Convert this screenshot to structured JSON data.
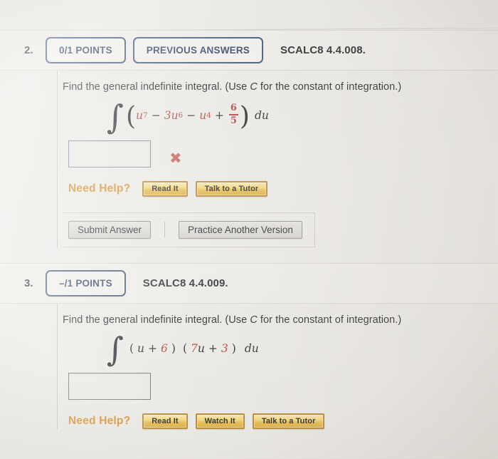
{
  "questions": [
    {
      "number": "2.",
      "points_label": "0/1 POINTS",
      "previous_answers_label": "PREVIOUS ANSWERS",
      "code": "SCALC8 4.4.008.",
      "prompt_before": "Find the general indefinite integral. (Use ",
      "prompt_var": "C",
      "prompt_after": " for the constant of integration.)",
      "integral": {
        "symbol": "∫",
        "open_paren": "(",
        "close_paren": ")",
        "terms": [
          {
            "base": "u",
            "exp": "7",
            "coef": "",
            "op": ""
          },
          {
            "base": "u",
            "exp": "6",
            "coef": "3",
            "op": "−"
          },
          {
            "base": "u",
            "exp": "4",
            "coef": "",
            "op": "−"
          }
        ],
        "plus_op": "+",
        "fraction_num": "6",
        "fraction_den": "5",
        "differential": "du"
      },
      "answer_value": "",
      "answer_status_icon": "✖",
      "answer_status_name": "incorrect-x-icon",
      "need_help_label": "Need Help?",
      "help_buttons": [
        "Read It",
        "Talk to a Tutor"
      ],
      "submit_label": "Submit Answer",
      "practice_label": "Practice Another Version"
    },
    {
      "number": "3.",
      "points_label": "–/1 POINTS",
      "previous_answers_label": "",
      "code": "SCALC8 4.4.009.",
      "prompt_before": "Find the general indefinite integral. (Use ",
      "prompt_var": "C",
      "prompt_after": " for the constant of integration.)",
      "integral": {
        "symbol": "∫",
        "factor1_open": "(",
        "factor1_var": "u",
        "factor1_op": "+",
        "factor1_const": "6",
        "factor1_close": ")",
        "factor2_open": "(",
        "factor2_coef": "7",
        "factor2_var": "u",
        "factor2_op": "+",
        "factor2_const": "3",
        "factor2_close": ")",
        "differential": "du"
      },
      "answer_value": "",
      "need_help_label": "Need Help?",
      "help_buttons": [
        "Read It",
        "Watch It",
        "Talk to a Tutor"
      ]
    }
  ],
  "colors": {
    "pill_border": "#3d5277",
    "accent_red": "#b23a35",
    "need_help_orange": "#d8891f",
    "gold_button": "#e8bc49",
    "x_mark_red": "#c4564f",
    "page_background": "#eceae5"
  }
}
